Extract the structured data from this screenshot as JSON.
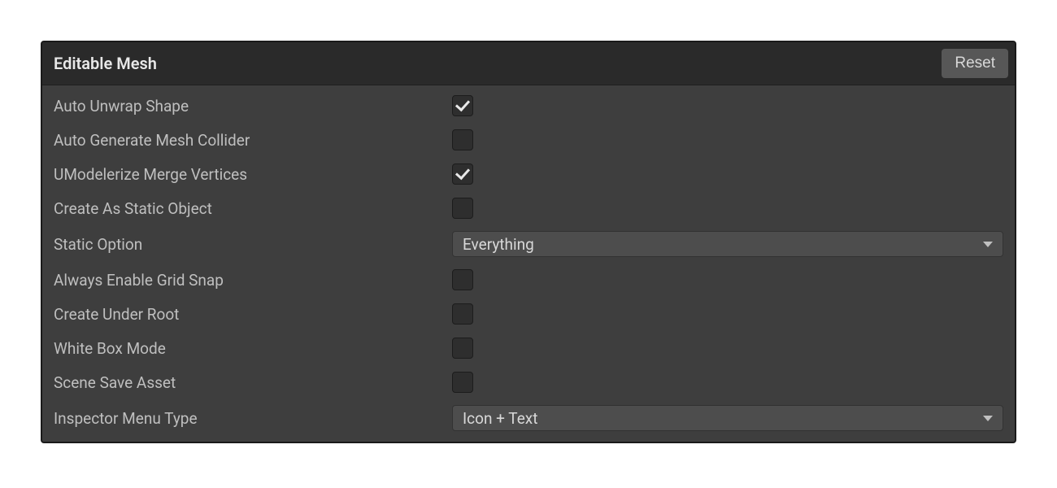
{
  "header": {
    "title": "Editable Mesh",
    "reset_label": "Reset"
  },
  "rows": {
    "auto_unwrap_shape": {
      "label": "Auto Unwrap Shape",
      "checked": true
    },
    "auto_generate_mesh_collider": {
      "label": "Auto Generate Mesh Collider",
      "checked": false
    },
    "umodelerize_merge_vertices": {
      "label": "UModelerize Merge Vertices",
      "checked": true
    },
    "create_as_static_object": {
      "label": "Create As Static Object",
      "checked": false
    },
    "static_option": {
      "label": "Static Option",
      "value": "Everything"
    },
    "always_enable_grid_snap": {
      "label": "Always Enable Grid Snap",
      "checked": false
    },
    "create_under_root": {
      "label": "Create Under Root",
      "checked": false
    },
    "white_box_mode": {
      "label": "White Box Mode",
      "checked": false
    },
    "scene_save_asset": {
      "label": "Scene Save Asset",
      "checked": false
    },
    "inspector_menu_type": {
      "label": "Inspector Menu Type",
      "value": "Icon + Text"
    }
  }
}
